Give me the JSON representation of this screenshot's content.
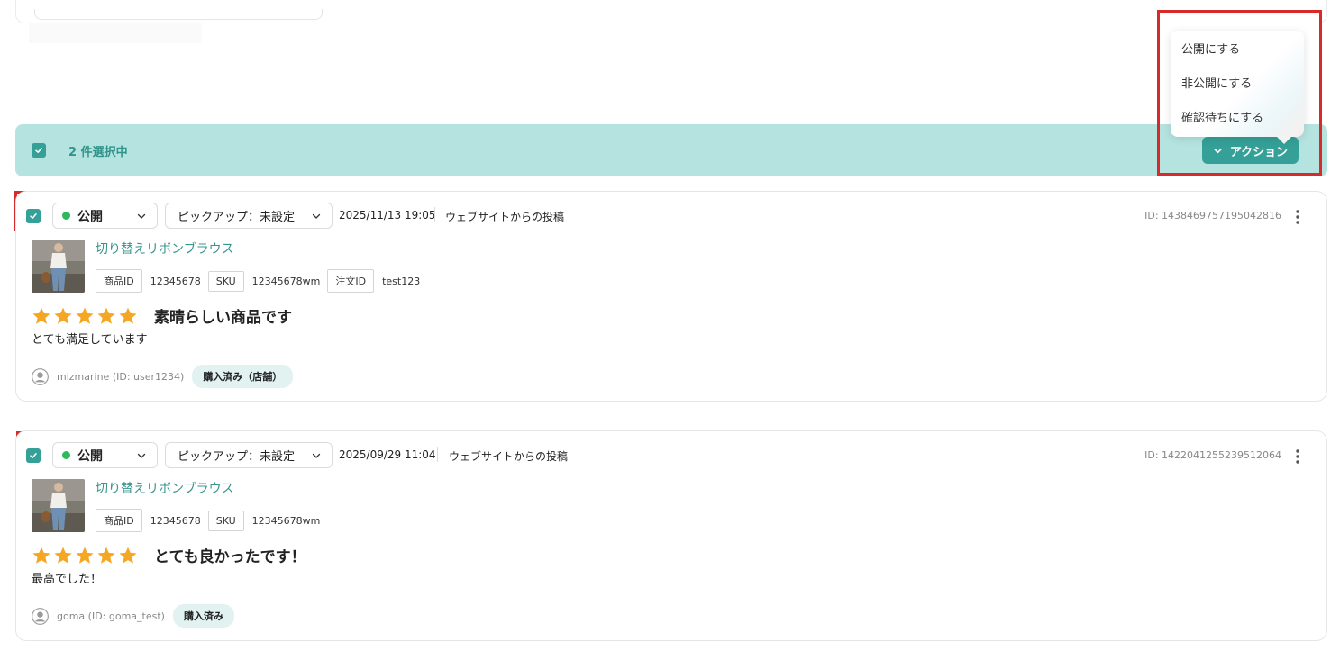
{
  "selection": {
    "count_label": "2 件選択中",
    "action_label": "アクション"
  },
  "action_menu": {
    "items": [
      "公開にする",
      "非公開にする",
      "確認待ちにする"
    ]
  },
  "colors": {
    "accent": "#35a097",
    "bar_bg": "#b5e3e0",
    "star": "#f5a623",
    "status_dot": "#2fb85c",
    "highlight": "#d72b2b"
  },
  "reviews": [
    {
      "status": "公開",
      "pickup": "ピックアップ：未設定",
      "datetime": "2025/11/13 19:05",
      "source": "ウェブサイトからの投稿",
      "id_label": "ID: 1438469757195042816",
      "product_name": "切り替えリボンブラウス",
      "tags": [
        {
          "label": "商品ID",
          "value": "12345678"
        },
        {
          "label": "SKU",
          "value": "12345678wm"
        },
        {
          "label": "注文ID",
          "value": "test123"
        }
      ],
      "rating": 5,
      "title": "素晴らしい商品です",
      "body": "とても満足しています",
      "user": "mizmarine (ID: user1234)",
      "purchase_badge": "購入済み（店舗）"
    },
    {
      "status": "公開",
      "pickup": "ピックアップ：未設定",
      "datetime": "2025/09/29 11:04",
      "source": "ウェブサイトからの投稿",
      "id_label": "ID: 1422041255239512064",
      "product_name": "切り替えリボンブラウス",
      "tags": [
        {
          "label": "商品ID",
          "value": "12345678"
        },
        {
          "label": "SKU",
          "value": "12345678wm"
        }
      ],
      "rating": 5,
      "title": "とても良かったです！",
      "body": "最高でした！",
      "user": "goma (ID: goma_test)",
      "purchase_badge": "購入済み"
    }
  ]
}
